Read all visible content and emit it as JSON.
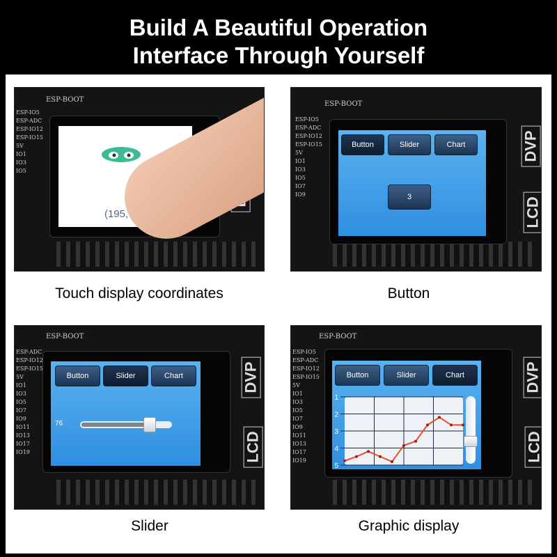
{
  "header": {
    "line1": "Build A Beautiful Operation",
    "line2": "Interface Through Yourself"
  },
  "board_labels": {
    "boot": "ESP-BOOT",
    "lcd": "LCD",
    "dvp": "DVP",
    "pins": [
      "ESP-IO5",
      "ESP-ADC",
      "ESP-IO12",
      "ESP-IO15",
      "5V",
      "IO1",
      "IO3",
      "IO5",
      "IO7",
      "IO9",
      "IO11",
      "IO13",
      "IO17",
      "IO19"
    ]
  },
  "panels": [
    {
      "caption": "Touch display coordinates",
      "screen": {
        "coordinates": "(195, 92)"
      }
    },
    {
      "caption": "Button",
      "screen": {
        "tabs": [
          "Button",
          "Slider",
          "Chart"
        ],
        "button_value": "3"
      }
    },
    {
      "caption": "Slider",
      "screen": {
        "tabs": [
          "Button",
          "Slider",
          "Chart"
        ],
        "slider_value": "76",
        "slider_percent": 76
      }
    },
    {
      "caption": "Graphic display",
      "screen": {
        "tabs": [
          "Button",
          "Slider",
          "Chart"
        ],
        "active_tab": "Chart",
        "vertical_slider_percent": 25
      }
    }
  ],
  "chart_data": {
    "type": "line",
    "y_ticks": [
      "1",
      "2",
      "3",
      "4",
      "5"
    ],
    "ylim": [
      1,
      5
    ],
    "y_inverted": true,
    "grid": true,
    "x": [
      0,
      1,
      2,
      3,
      4,
      5,
      6,
      7,
      8,
      9,
      10
    ],
    "values": [
      4.75,
      4.5,
      4.2,
      4.5,
      4.8,
      3.85,
      3.6,
      2.65,
      2.2,
      2.65,
      2.65
    ],
    "line_color": "#f04a2a"
  },
  "colors": {
    "screen_blue": "#3f9fe8",
    "tab": "#1f3a5c",
    "logo_green": "#3dbb94"
  }
}
